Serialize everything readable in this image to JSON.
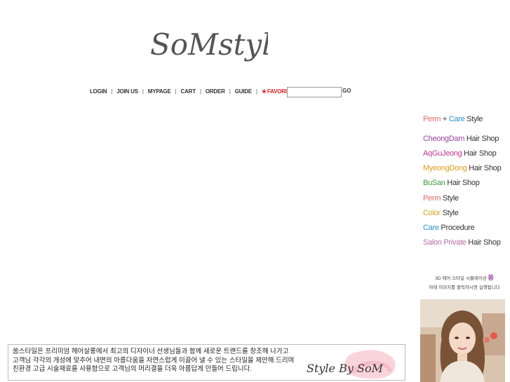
{
  "logo": {
    "text": "SoMstyle"
  },
  "nav": {
    "items": [
      "LOGIN",
      "JOIN US",
      "MYPAGE",
      "CART",
      "ORDER",
      "GUIDE"
    ],
    "favorite_star": "★",
    "favorite": "FAVORITE",
    "separator": "|"
  },
  "search": {
    "value": "",
    "go_label": "GO"
  },
  "sidebar": {
    "perm_care": {
      "a": "Perm",
      "plus": "+",
      "b": "Care",
      "c": "Style"
    },
    "links": [
      {
        "key": "CheongDam",
        "rest": "Hair Shop",
        "color": "#9b3fa6"
      },
      {
        "key": "AqGuJeong",
        "rest": "Hair Shop",
        "color": "#c2348f"
      },
      {
        "key": "MyeongDong",
        "rest": "Hair Shop",
        "color": "#e39c1b"
      },
      {
        "key": "BuSan",
        "rest": "Hair Shop",
        "color": "#3a9b3a"
      },
      {
        "key": "Perm",
        "rest": "Style",
        "color": "#e8666a"
      },
      {
        "key": "Color",
        "rest": "Style",
        "color": "#d8a51b"
      },
      {
        "key": "Care",
        "rest": "Procedure",
        "color": "#2a8fd1"
      },
      {
        "key": "Salon Private",
        "rest": "Hair Shop",
        "color": "#b86aa6"
      }
    ]
  },
  "promo": {
    "line1_prefix": "3D 헤어 스타일 시뮬레이션",
    "line1_highlight": "쏨",
    "line2": "아래 이미지를 클릭하시면 실행됩니다"
  },
  "footer_box": {
    "lines": [
      "쏨스타일은 프리미엄 헤어살롱에서 최고의 디자이너 선생님들과 함께 새로운 트랜드를 창조해 나가고",
      "고객님 각각의 개성에 맞추어 내면의 아름다움을 자연스럽게 이끌어 낼 수 있는 스타일을 제안해 드리며",
      "친환경 고급 시술재료를 사용함으로 고객님의 머리결을 더욱 아름답게 만들어 드립니다."
    ],
    "signature": "Style By SoM"
  }
}
